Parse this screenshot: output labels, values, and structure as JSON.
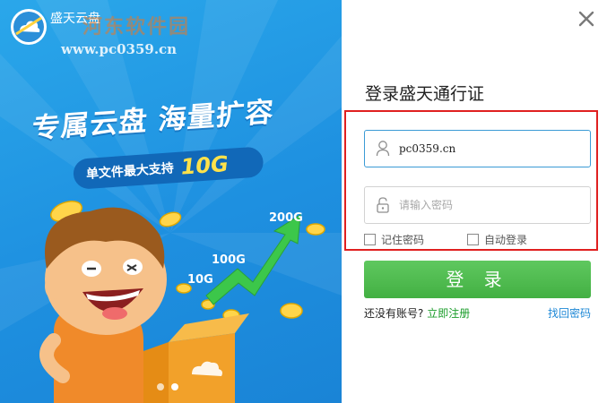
{
  "window": {
    "app_title": "盛天云盘",
    "watermark_cn": "河东软件园",
    "watermark_url": "www.pc0359.cn"
  },
  "banner": {
    "headline": "专属云盘 海量扩容",
    "pill_text": "单文件最大支持",
    "pill_size": "10G",
    "growth_labels": [
      "200G",
      "100G",
      "10G"
    ],
    "carousel": {
      "count": 2,
      "active": 1
    }
  },
  "login": {
    "title": "登录盛天通行证",
    "username_value": "pc0359.cn",
    "password_placeholder": "请输入密码",
    "remember_label": "记住密码",
    "remember_checked": false,
    "auto_login_label": "自动登录",
    "auto_login_checked": false,
    "login_button": "登 录",
    "no_account_text": "还没有账号?",
    "register_link": "立即注册",
    "forgot_link": "找回密码"
  },
  "icons": {
    "close": "close-icon",
    "user": "user-icon",
    "lock": "lock-icon",
    "logo": "cloud-logo-icon"
  },
  "colors": {
    "banner_blue": "#1e90e0",
    "login_green": "#43b043",
    "highlight_red": "#e02020",
    "link_green": "#1a9d2a",
    "link_blue": "#1e88d6",
    "field_focus": "#3b9bd6",
    "accent_yellow": "#ffe14a"
  }
}
